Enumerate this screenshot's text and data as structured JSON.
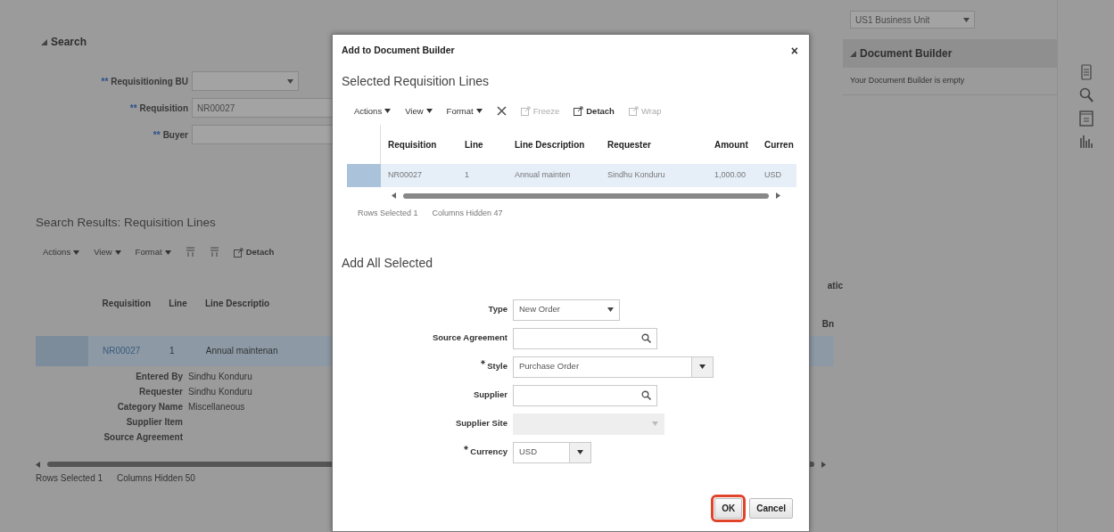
{
  "search": {
    "title": "Search",
    "fields": [
      {
        "label": "Requisitioning BU",
        "required_mark": "**",
        "kind": "select"
      },
      {
        "label": "Requisition",
        "required_mark": "**",
        "kind": "text",
        "value": "NR00027"
      },
      {
        "label": "Buyer",
        "required_mark": "**",
        "kind": "text"
      }
    ]
  },
  "results": {
    "title": "Search Results: Requisition Lines",
    "toolbar": [
      {
        "kind": "menu",
        "label": "Actions"
      },
      {
        "kind": "menu",
        "label": "View"
      },
      {
        "kind": "menu",
        "label": "Format"
      },
      {
        "kind": "icon"
      },
      {
        "kind": "icon"
      },
      {
        "kind": "button",
        "label": "Detach"
      }
    ],
    "columns": [
      "Requisition",
      "Line",
      "Line Descriptio"
    ],
    "rows": [
      {
        "selected": true,
        "cells": [
          "NR00027",
          "1",
          "Annual maintenan"
        ],
        "details": [
          {
            "label": "Entered By",
            "value": "Sindhu Konduru"
          },
          {
            "label": "Requester",
            "value": "Sindhu Konduru"
          },
          {
            "label": "Category Name",
            "value": "Miscellaneous"
          },
          {
            "label": "Supplier Item"
          },
          {
            "label": "Source Agreement"
          }
        ]
      }
    ],
    "partial_headers": [
      "atic",
      "Bn"
    ],
    "rows_selected": "Rows Selected 1",
    "columns_hidden": "Columns Hidden 50"
  },
  "document_builder": {
    "business_unit": "US1 Business Unit",
    "title": "Document Builder",
    "message": "Your Document Builder is empty"
  },
  "dialog": {
    "title": "Add to Document Builder",
    "close": "×",
    "section_title": "Selected Requisition Lines",
    "toolbar": [
      {
        "kind": "menu",
        "label": "Actions",
        "disabled": false
      },
      {
        "kind": "menu",
        "label": "View",
        "disabled": false
      },
      {
        "kind": "menu",
        "label": "Format",
        "disabled": false
      },
      {
        "kind": "icon",
        "disabled": false
      },
      {
        "kind": "button",
        "label": "Freeze",
        "disabled": true
      },
      {
        "kind": "button",
        "label": "Detach",
        "disabled": false
      },
      {
        "kind": "button",
        "label": "Wrap",
        "disabled": true
      }
    ],
    "columns": [
      "Requisition",
      "Line",
      "Line Description",
      "Requester",
      "Amount",
      "Curren"
    ],
    "rows": [
      {
        "selected": true,
        "cells": [
          "NR00027",
          "1",
          "Annual mainten",
          "Sindhu Konduru",
          "1,000.00",
          "USD"
        ]
      }
    ],
    "rows_selected": "Rows Selected 1",
    "columns_hidden": "Columns Hidden 47",
    "form_title": "Add All Selected",
    "fields": [
      {
        "label": "Type",
        "kind": "select",
        "required": false,
        "disabled": false,
        "value": "New Order"
      },
      {
        "label": "Source Agreement",
        "kind": "search",
        "required": false,
        "disabled": false
      },
      {
        "label": "Style",
        "kind": "combo",
        "required": true,
        "disabled": false,
        "value": "Purchase Order"
      },
      {
        "label": "Supplier",
        "kind": "search",
        "required": false,
        "disabled": false
      },
      {
        "label": "Supplier Site",
        "kind": "select",
        "required": false,
        "disabled": true
      },
      {
        "label": "Currency",
        "kind": "combo",
        "required": true,
        "disabled": false,
        "value": "USD"
      }
    ],
    "buttons": [
      {
        "label": "OK",
        "highlighted": true
      },
      {
        "label": "Cancel",
        "highlighted": false
      }
    ]
  }
}
